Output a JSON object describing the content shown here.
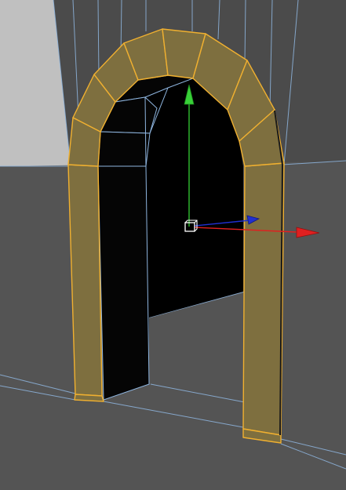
{
  "viewport": {
    "view_type": "perspective",
    "selection": "arch-doorway",
    "colors": {
      "background": "#505050",
      "backdrop_wall": "#4c4c4c",
      "floor": "#555555",
      "light_panel": "#c0c0c0",
      "grid_line": "#8fb6e0",
      "arch_face": "#7e6f3f",
      "arch_edge": "#f0b030",
      "void": "#000000",
      "gizmo_y": "#30c030",
      "gizmo_x": "#e02020",
      "gizmo_z": "#2030d0"
    }
  },
  "gizmo": {
    "axes": [
      "y",
      "x",
      "z"
    ],
    "pivot_icon": "box-pivot-icon"
  }
}
